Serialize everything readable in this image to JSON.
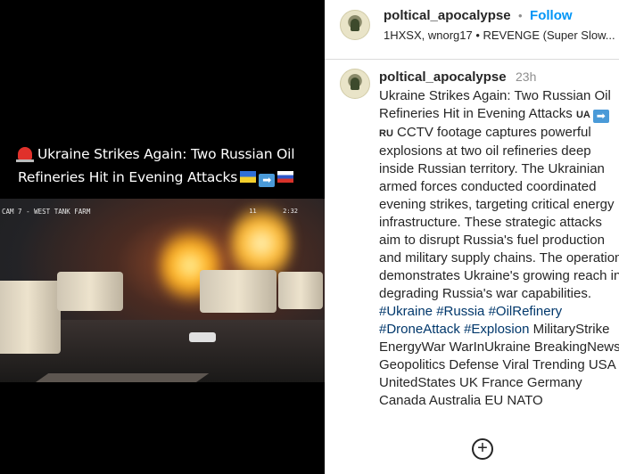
{
  "media": {
    "title_line1": "Ukraine Strikes Again: Two Russian Oil",
    "title_line2": "Refineries Hit in Evening Attacks",
    "cam_label": "CAM 7 - WEST TANK FARM",
    "cam_corner": "11",
    "cam_time": "2:32"
  },
  "header": {
    "username": "poltical_apocalypse",
    "separator": "•",
    "follow_label": "Follow",
    "subline": "1HXSX, wnorg17 • REVENGE (Super Slow..."
  },
  "comment": {
    "username": "poltical_apocalypse",
    "time": "23h",
    "caption_start": "Ukraine Strikes Again: Two Russian Oil Refineries Hit in Evening Attacks ",
    "ua_tag": "UA",
    "ru_tag": "RU",
    "caption_body": " CCTV footage captures powerful explosions at two oil refineries deep inside Russian territory. The Ukrainian armed forces conducted coordinated evening strikes, targeting critical energy infrastructure. These strategic attacks aim to disrupt Russia's fuel production and military supply chains. The operation demonstrates Ukraine's growing reach in degrading Russia's war capabilities. ",
    "hashtags": [
      "#Ukraine",
      "#Russia",
      "#OilRefinery",
      "#DroneAttack",
      "#Explosion"
    ],
    "plain_tags": "MilitaryStrike EnergyWar WarInUkraine BreakingNews Geopolitics Defense Viral Trending USA UnitedStates UK France Germany Canada Australia EU NATO"
  },
  "actions": {
    "more_label": "+"
  }
}
